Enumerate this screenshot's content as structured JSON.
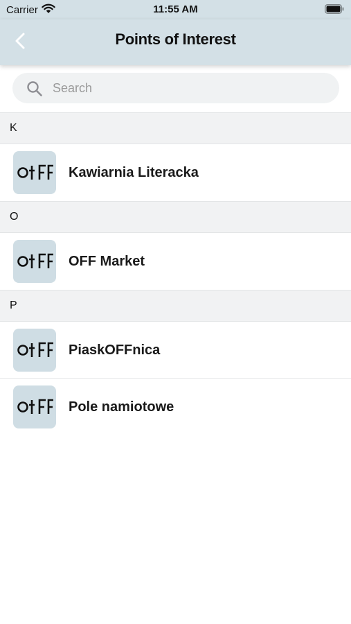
{
  "status_bar": {
    "carrier": "Carrier",
    "time": "11:55 AM",
    "icons": [
      "wifi-icon",
      "battery-icon"
    ]
  },
  "nav": {
    "title": "Points of Interest",
    "back_icon": "chevron-left-icon"
  },
  "search": {
    "placeholder": "Search",
    "value": "",
    "icon": "search-icon"
  },
  "sections": [
    {
      "letter": "K",
      "items": [
        {
          "label": "Kawiarnia Literacka",
          "thumb_text": "OFF"
        }
      ]
    },
    {
      "letter": "O",
      "items": [
        {
          "label": "OFF Market",
          "thumb_text": "OFF"
        }
      ]
    },
    {
      "letter": "P",
      "items": [
        {
          "label": "PiaskOFFnica",
          "thumb_text": "OFF"
        },
        {
          "label": "Pole namiotowe",
          "thumb_text": "OFF"
        }
      ]
    }
  ],
  "colors": {
    "nav_background": "#d3e0e6",
    "thumb_background": "#cfdde4",
    "section_background": "#f1f2f3"
  }
}
